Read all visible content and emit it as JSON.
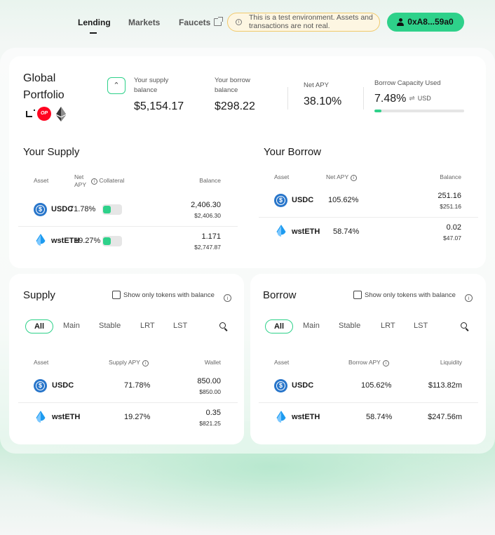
{
  "nav": {
    "lending": "Lending",
    "markets": "Markets",
    "faucets": "Faucets",
    "banner": "This is a test environment. Assets and transactions are not real.",
    "wallet": "0xA8...59a0"
  },
  "portfolio": {
    "title": "Global Portfolio",
    "supply_balance_label": "Your supply balance",
    "supply_balance": "$5,154.17",
    "borrow_balance_label": "Your borrow balance",
    "borrow_balance": "$298.22",
    "net_apy_label": "Net APY",
    "net_apy": "38.10%",
    "capacity_label": "Borrow Capacity Used",
    "capacity_value": "7.48%",
    "capacity_unit": "USD",
    "capacity_fraction": 0.0748
  },
  "your_supply": {
    "title": "Your Supply",
    "headers": {
      "asset": "Asset",
      "net_apy": "Net APY",
      "collateral": "Collateral",
      "balance": "Balance"
    },
    "rows": [
      {
        "asset": "USDC",
        "apy": "71.78%",
        "balance": "2,406.30",
        "balance_usd": "$2,406.30",
        "collateral": true
      },
      {
        "asset": "wstETH",
        "apy": "19.27%",
        "balance": "1.171",
        "balance_usd": "$2,747.87",
        "collateral": true
      }
    ]
  },
  "your_borrow": {
    "title": "Your Borrow",
    "headers": {
      "asset": "Asset",
      "net_apy": "Net APY",
      "balance": "Balance"
    },
    "rows": [
      {
        "asset": "USDC",
        "apy": "105.62%",
        "balance": "251.16",
        "balance_usd": "$251.16"
      },
      {
        "asset": "wstETH",
        "apy": "58.74%",
        "balance": "0.02",
        "balance_usd": "$47.07"
      }
    ]
  },
  "supply_market": {
    "title": "Supply",
    "filter_label": "Show only tokens with balance",
    "tabs": [
      "All",
      "Main",
      "Stable",
      "LRT",
      "LST"
    ],
    "headers": {
      "asset": "Asset",
      "apy": "Supply APY",
      "wallet": "Wallet"
    },
    "rows": [
      {
        "asset": "USDC",
        "apy": "71.78%",
        "wallet": "850.00",
        "wallet_usd": "$850.00"
      },
      {
        "asset": "wstETH",
        "apy": "19.27%",
        "wallet": "0.35",
        "wallet_usd": "$821.25"
      }
    ]
  },
  "borrow_market": {
    "title": "Borrow",
    "filter_label": "Show only tokens with balance",
    "tabs": [
      "All",
      "Main",
      "Stable",
      "LRT",
      "LST"
    ],
    "headers": {
      "asset": "Asset",
      "apy": "Borrow APY",
      "liquidity": "Liquidity"
    },
    "rows": [
      {
        "asset": "USDC",
        "apy": "105.62%",
        "liquidity": "$113.82m"
      },
      {
        "asset": "wstETH",
        "apy": "58.74%",
        "liquidity": "$247.56m"
      }
    ]
  },
  "icons": {
    "usdc": "usdc-token-icon",
    "wsteth": "wsteth-token-icon",
    "chains": [
      "linea-icon",
      "optimism-icon",
      "ethereum-icon"
    ]
  },
  "colors": {
    "accent": "#2ed18a",
    "usdc": "#2775ca",
    "op": "#ff0420",
    "banner_border": "#f1c96c"
  }
}
